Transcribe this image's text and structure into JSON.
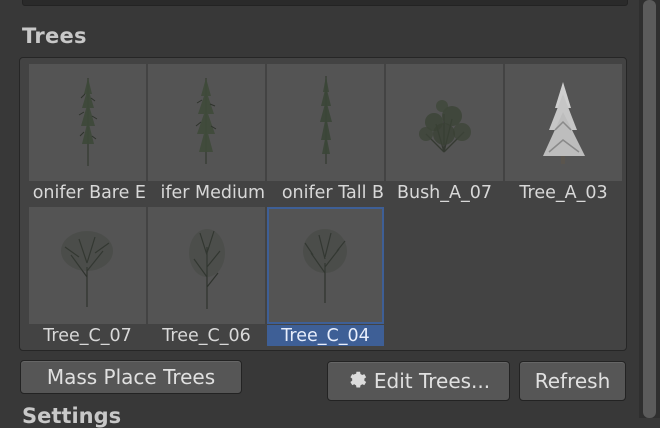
{
  "section": {
    "title": "Trees"
  },
  "tiles": [
    {
      "label": "onifer Bare E",
      "thumb": "conifer-bare"
    },
    {
      "label": "ifer Medium",
      "thumb": "conifer-medium"
    },
    {
      "label": "onifer Tall B",
      "thumb": "conifer-tall"
    },
    {
      "label": "Bush_A_07",
      "thumb": "bush"
    },
    {
      "label": "Tree_A_03",
      "thumb": "snowy-tree"
    },
    {
      "label": "Tree_C_07",
      "thumb": "deciduous-tree"
    },
    {
      "label": "Tree_C_06",
      "thumb": "deciduous-tree"
    },
    {
      "label": "Tree_C_04",
      "thumb": "deciduous-tree",
      "selected": true
    }
  ],
  "buttons": {
    "mass_place": "Mass Place Trees",
    "edit_trees": "Edit Trees...",
    "edit_icon": "gear-icon",
    "refresh": "Refresh"
  },
  "next_section": {
    "title": "Settings"
  },
  "colors": {
    "background": "#383838",
    "panel": "#434343",
    "thumb_bg": "#545454",
    "selection": "#3e5f96",
    "button": "#565656"
  }
}
